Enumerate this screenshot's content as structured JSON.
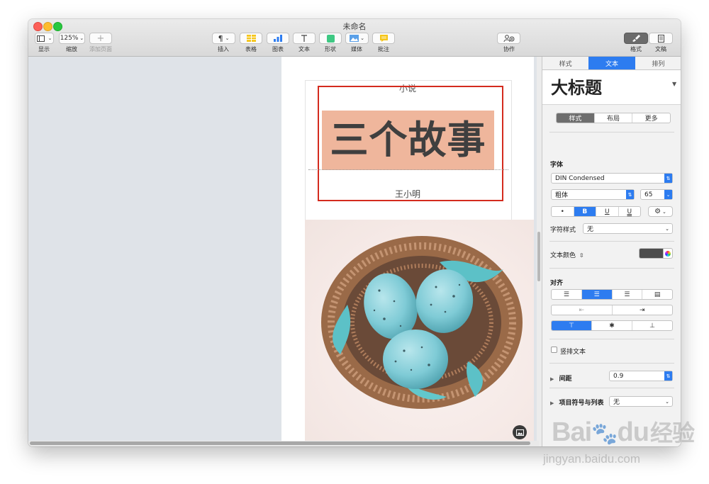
{
  "window": {
    "title": "未命名"
  },
  "toolbar": {
    "view_label": "显示",
    "zoom_value": "125%",
    "zoom_label": "缩放",
    "add_page_label": "添加页面",
    "insert_label": "插入",
    "table_label": "表格",
    "chart_label": "图表",
    "text_label": "文本",
    "shape_label": "形状",
    "media_label": "媒体",
    "comment_label": "批注",
    "collaborate_label": "协作",
    "format_label": "格式",
    "document_label": "文稿"
  },
  "document": {
    "subtitle": "小说",
    "title": "三个故事",
    "author": "王小明"
  },
  "inspector": {
    "tabs": [
      "样式",
      "文本",
      "排列"
    ],
    "active_tab": "文本",
    "paragraph_style": "大标题",
    "sub_tabs": [
      "样式",
      "布局",
      "更多"
    ],
    "font_section": "字体",
    "font_name": "DIN Condensed",
    "font_weight": "粗体",
    "font_size": "65",
    "style_buttons": [
      "•",
      "B",
      "U",
      "U"
    ],
    "char_style_label": "字符样式",
    "char_style_value": "无",
    "text_color_label": "文本颜色",
    "text_color": "#4d4d4d",
    "align_section": "对齐",
    "vertical_text_label": "竖排文本",
    "spacing_label": "间距",
    "spacing_value": "0.9",
    "bullets_label": "项目符号与列表",
    "bullets_value": "无"
  },
  "watermark": {
    "brand": "Bai",
    "brand2": "du",
    "brand_cn": "经验",
    "url": "jingyan.baidu.com"
  },
  "colors": {
    "accent": "#2d7cf0",
    "selection": "#d42b1e",
    "title_bg": "#efb69c"
  }
}
